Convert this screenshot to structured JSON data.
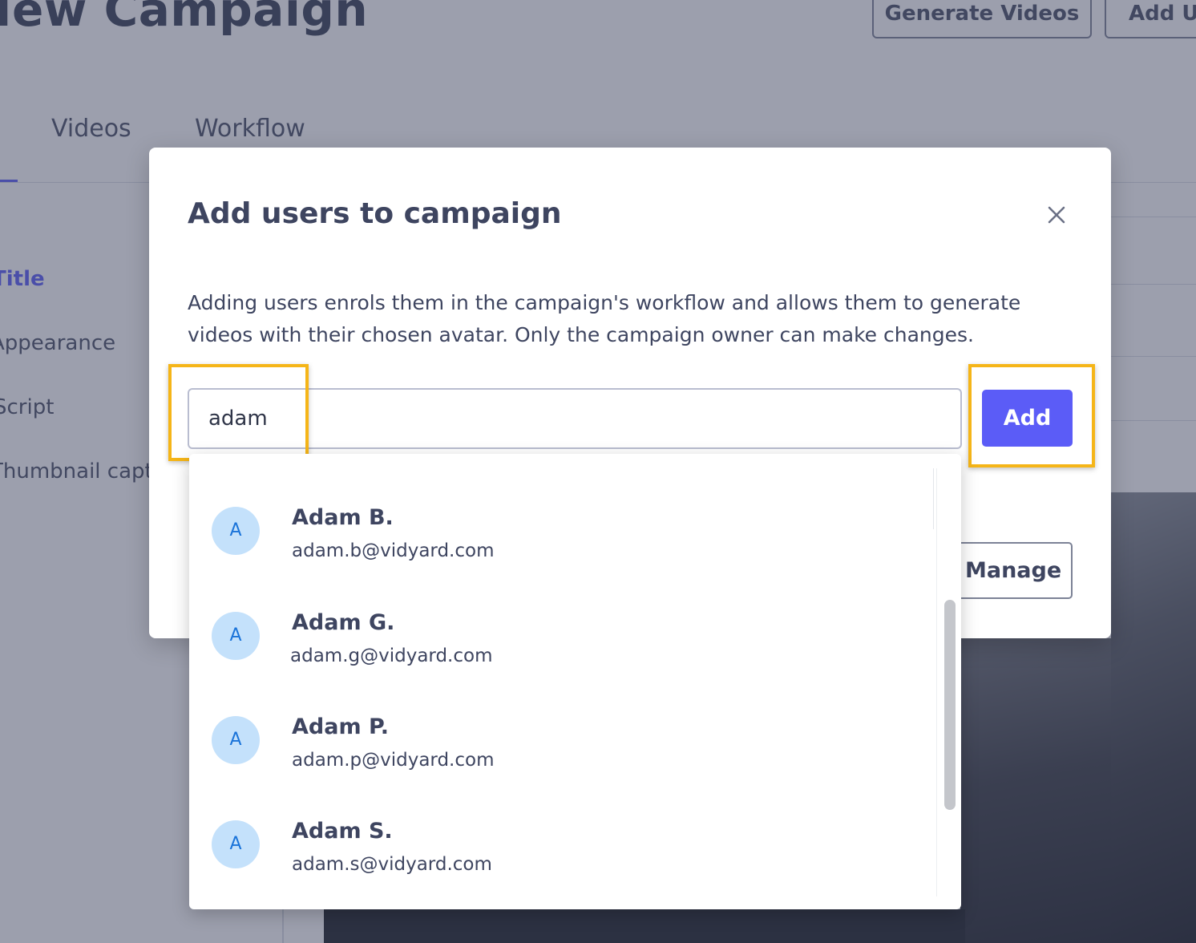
{
  "page": {
    "title": "New Campaign",
    "buttons": {
      "generate_videos": "Generate Videos",
      "add_users": "Add Users"
    },
    "tabs": [
      {
        "label": "Videos"
      },
      {
        "label": "Workflow"
      }
    ],
    "sidebar": {
      "items": [
        {
          "label": "Title",
          "active": true
        },
        {
          "label": "Appearance"
        },
        {
          "label": "Script"
        },
        {
          "label": "Thumbnail caption"
        }
      ]
    }
  },
  "modal": {
    "title": "Add users to campaign",
    "description": "Adding users enrols them in the campaign's workflow and allows them to generate videos with their chosen avatar. Only the campaign owner can make changes.",
    "search": {
      "value": "adam",
      "placeholder": ""
    },
    "add_label": "Add",
    "manage_label": "Manage"
  },
  "dropdown": {
    "items": [
      {
        "initial": "A",
        "name": "Adam B.",
        "email": "adam.b@vidyard.com"
      },
      {
        "initial": "A",
        "name": "Adam G.",
        "email": "adam.g@vidyard.com"
      },
      {
        "initial": "A",
        "name": "Adam P.",
        "email": "adam.p@vidyard.com"
      },
      {
        "initial": "A",
        "name": "Adam S.",
        "email": "adam.s@vidyard.com"
      }
    ]
  },
  "colors": {
    "accent": "#5b5cf7",
    "highlight": "#f5b518",
    "avatar_bg": "#c4e1fb",
    "avatar_text": "#1a73d9",
    "text": "#3e4560"
  },
  "icons": {
    "close": "close-icon"
  }
}
